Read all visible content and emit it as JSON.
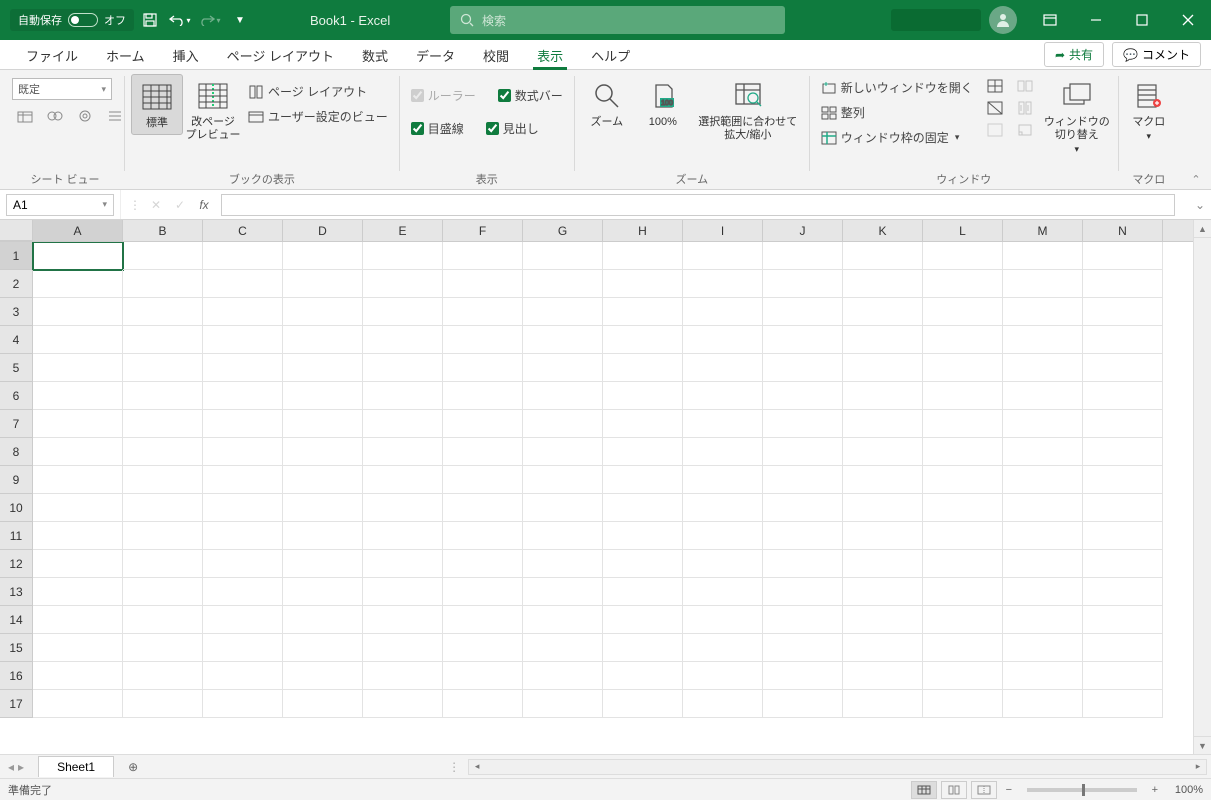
{
  "titlebar": {
    "autosave_label": "自動保存",
    "autosave_state": "オフ",
    "doc_title": "Book1  -  Excel",
    "search_placeholder": "検索"
  },
  "tabs": {
    "items": [
      "ファイル",
      "ホーム",
      "挿入",
      "ページ レイアウト",
      "数式",
      "データ",
      "校閲",
      "表示",
      "ヘルプ"
    ],
    "active_index": 7,
    "share": "共有",
    "comment": "コメント"
  },
  "ribbon": {
    "sheetview": {
      "default": "既定",
      "group_label": "シート ビュー"
    },
    "bookview": {
      "normal": "標準",
      "pagebreak": "改ページ\nプレビュー",
      "pagelayout": "ページ レイアウト",
      "custom": "ユーザー設定のビュー",
      "group_label": "ブックの表示"
    },
    "show": {
      "ruler": "ルーラー",
      "formula_bar": "数式バー",
      "gridlines": "目盛線",
      "headings": "見出し",
      "group_label": "表示"
    },
    "zoom": {
      "zoom": "ズーム",
      "hundred": "100%",
      "fit": "選択範囲に合わせて\n拡大/縮小",
      "group_label": "ズーム"
    },
    "window": {
      "new_window": "新しいウィンドウを開く",
      "arrange": "整列",
      "freeze": "ウィンドウ枠の固定",
      "switch": "ウィンドウの\n切り替え",
      "group_label": "ウィンドウ"
    },
    "macro": {
      "macro": "マクロ",
      "group_label": "マクロ"
    }
  },
  "formula_bar": {
    "cell_ref": "A1",
    "formula": ""
  },
  "grid": {
    "columns": [
      "A",
      "B",
      "C",
      "D",
      "E",
      "F",
      "G",
      "H",
      "I",
      "J",
      "K",
      "L",
      "M",
      "N"
    ],
    "row_count": 17,
    "selected": {
      "row": 1,
      "col": "A"
    }
  },
  "sheets": {
    "active": "Sheet1"
  },
  "status": {
    "ready": "準備完了",
    "zoom": "100%"
  }
}
